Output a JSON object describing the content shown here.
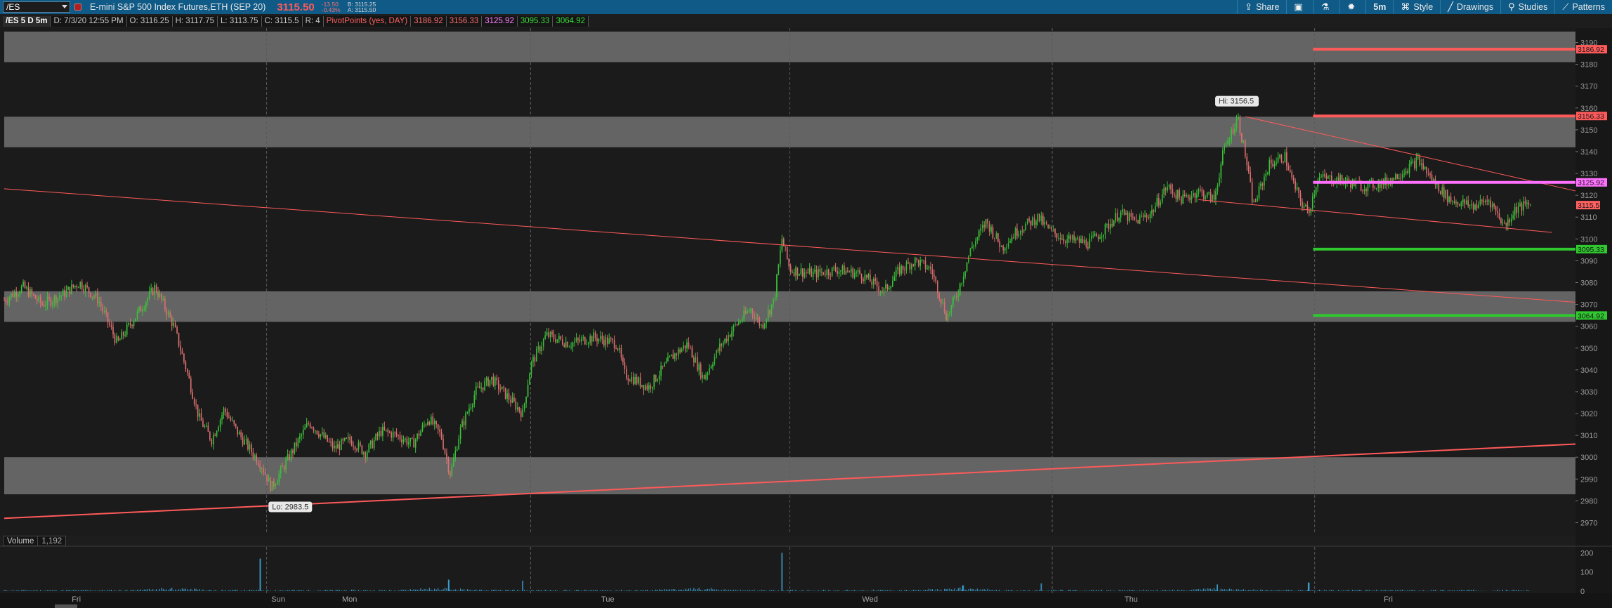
{
  "toolbar": {
    "symbol": "/ES",
    "instrument_title": "E-mini S&P 500 Index Futures,ETH (SEP 20)",
    "last_price": "3115.50",
    "change": "-13.50",
    "change_pct": "-0.43%",
    "bid": "B: 3115.25",
    "ask": "A: 3115.50",
    "buttons": [
      {
        "label": "Share",
        "icon": "share-icon"
      },
      {
        "label": "",
        "icon": "flag-icon"
      },
      {
        "label": "",
        "icon": "flask-icon"
      },
      {
        "label": "",
        "icon": "gear-icon"
      },
      {
        "label": "5m",
        "icon": ""
      },
      {
        "label": "Style",
        "icon": "style-icon"
      },
      {
        "label": "Drawings",
        "icon": "pencil-icon"
      },
      {
        "label": "Studies",
        "icon": "studies-icon"
      },
      {
        "label": "Patterns",
        "icon": "patterns-icon"
      }
    ],
    "share_label": "Share",
    "timeframe_label": "5m",
    "style_label": "Style",
    "drawings_label": "Drawings",
    "studies_label": "Studies",
    "patterns_label": "Patterns"
  },
  "info": {
    "symbol_period": "/ES 5 D 5m",
    "date_time": "D: 7/3/20 12:55 PM",
    "open": "O: 3116.25",
    "high": "H: 3117.75",
    "low": "L: 3113.75",
    "close": "C: 3115.5",
    "range": "R: 4",
    "pivot_label": "PivotPoints (yes, DAY)",
    "r2": "3186.92",
    "r1": "3156.33",
    "pivot": "3125.92",
    "s1": "3095.33",
    "s2": "3064.92"
  },
  "volume_panel": {
    "label": "Volume",
    "value": "1,192",
    "yaxis": [
      "200",
      "100",
      "0"
    ]
  },
  "colors": {
    "background": "#1d1d1d",
    "topbar": "#0f5a86",
    "up_candle": "#39c539",
    "down_candle": "#e07070",
    "resistance": "#ff5a5a",
    "pivot": "#ff70ff",
    "support": "#2fc92f",
    "zone": "#7d7d7d",
    "trendline": "#ff5a5a",
    "volume": "#3a9bc9"
  },
  "chart_data": {
    "type": "candlestick",
    "ylim": [
      2965,
      3195
    ],
    "yticks": [
      2970,
      2980,
      2990,
      3000,
      3010,
      3020,
      3030,
      3040,
      3050,
      3060,
      3070,
      3080,
      3090,
      3100,
      3110,
      3120,
      3130,
      3140,
      3150,
      3160,
      3170,
      3180,
      3190
    ],
    "day_labels": [
      "Fri",
      "Sun",
      "Mon",
      "Tue",
      "Wed",
      "Thu",
      "Fri"
    ],
    "session_breaks": [
      0.167,
      0.335,
      0.5,
      0.667,
      0.834
    ],
    "hi_label": "Hi: 3156.5",
    "lo_label": "Lo: 2983.5",
    "current_price_label": "3115.5",
    "zones": [
      {
        "from": 3181,
        "to": 3195
      },
      {
        "from": 3142,
        "to": 3156
      },
      {
        "from": 3062,
        "to": 3076
      },
      {
        "from": 2983,
        "to": 3000
      }
    ],
    "pivot_levels": [
      {
        "name": "R2",
        "value": 3186.92,
        "label": "3186.92",
        "color": "#ff5a5a"
      },
      {
        "name": "R1",
        "value": 3156.33,
        "label": "3156.33",
        "color": "#ff5a5a"
      },
      {
        "name": "PP",
        "value": 3125.92,
        "label": "3125.92",
        "color": "#ff70ff"
      },
      {
        "name": "S1",
        "value": 3095.33,
        "label": "3095.33",
        "color": "#2fc92f"
      },
      {
        "name": "S2",
        "value": 3064.92,
        "label": "3064.92",
        "color": "#2fc92f"
      }
    ],
    "pivot_start": 0.833,
    "path_points": [
      [
        0.0,
        3072
      ],
      [
        0.012,
        3078
      ],
      [
        0.024,
        3070
      ],
      [
        0.036,
        3074
      ],
      [
        0.048,
        3080
      ],
      [
        0.06,
        3072
      ],
      [
        0.072,
        3052
      ],
      [
        0.084,
        3065
      ],
      [
        0.096,
        3078
      ],
      [
        0.108,
        3060
      ],
      [
        0.116,
        3040
      ],
      [
        0.124,
        3018
      ],
      [
        0.132,
        3008
      ],
      [
        0.14,
        3022
      ],
      [
        0.148,
        3012
      ],
      [
        0.156,
        3004
      ],
      [
        0.164,
        2996
      ],
      [
        0.17,
        2986
      ],
      [
        0.178,
        2996
      ],
      [
        0.186,
        3006
      ],
      [
        0.194,
        3016
      ],
      [
        0.202,
        3010
      ],
      [
        0.21,
        3004
      ],
      [
        0.22,
        3008
      ],
      [
        0.23,
        3002
      ],
      [
        0.24,
        3012
      ],
      [
        0.25,
        3010
      ],
      [
        0.26,
        3006
      ],
      [
        0.27,
        3018
      ],
      [
        0.278,
        3010
      ],
      [
        0.284,
        2992
      ],
      [
        0.29,
        3012
      ],
      [
        0.3,
        3030
      ],
      [
        0.31,
        3036
      ],
      [
        0.32,
        3028
      ],
      [
        0.33,
        3020
      ],
      [
        0.335,
        3042
      ],
      [
        0.345,
        3056
      ],
      [
        0.36,
        3052
      ],
      [
        0.375,
        3055
      ],
      [
        0.39,
        3052
      ],
      [
        0.395,
        3038
      ],
      [
        0.41,
        3032
      ],
      [
        0.425,
        3046
      ],
      [
        0.435,
        3052
      ],
      [
        0.445,
        3036
      ],
      [
        0.455,
        3050
      ],
      [
        0.465,
        3060
      ],
      [
        0.475,
        3068
      ],
      [
        0.482,
        3060
      ],
      [
        0.49,
        3072
      ],
      [
        0.495,
        3100
      ],
      [
        0.5,
        3086
      ],
      [
        0.515,
        3084
      ],
      [
        0.53,
        3086
      ],
      [
        0.545,
        3084
      ],
      [
        0.56,
        3076
      ],
      [
        0.57,
        3086
      ],
      [
        0.58,
        3090
      ],
      [
        0.59,
        3086
      ],
      [
        0.6,
        3064
      ],
      [
        0.607,
        3076
      ],
      [
        0.615,
        3095
      ],
      [
        0.625,
        3108
      ],
      [
        0.635,
        3096
      ],
      [
        0.645,
        3104
      ],
      [
        0.658,
        3110
      ],
      [
        0.665,
        3104
      ],
      [
        0.675,
        3100
      ],
      [
        0.69,
        3098
      ],
      [
        0.7,
        3104
      ],
      [
        0.71,
        3112
      ],
      [
        0.72,
        3108
      ],
      [
        0.73,
        3112
      ],
      [
        0.74,
        3124
      ],
      [
        0.75,
        3118
      ],
      [
        0.76,
        3122
      ],
      [
        0.77,
        3118
      ],
      [
        0.776,
        3140
      ],
      [
        0.785,
        3156
      ],
      [
        0.79,
        3138
      ],
      [
        0.795,
        3115
      ],
      [
        0.805,
        3134
      ],
      [
        0.815,
        3138
      ],
      [
        0.82,
        3126
      ],
      [
        0.826,
        3116
      ],
      [
        0.83,
        3112
      ],
      [
        0.836,
        3128
      ],
      [
        0.85,
        3127
      ],
      [
        0.865,
        3124
      ],
      [
        0.88,
        3126
      ],
      [
        0.9,
        3136
      ],
      [
        0.91,
        3126
      ],
      [
        0.92,
        3118
      ],
      [
        0.935,
        3115
      ],
      [
        0.945,
        3118
      ],
      [
        0.955,
        3106
      ],
      [
        0.962,
        3114
      ],
      [
        0.972,
        3116
      ]
    ],
    "trendlines": [
      {
        "x1": 0.0,
        "y1": 3123,
        "x2": 1.0,
        "y2": 3071,
        "width": 1
      },
      {
        "x1": 0.0,
        "y1": 2972,
        "x2": 1.0,
        "y2": 3006,
        "width": 2
      },
      {
        "x1": 0.79,
        "y1": 3156,
        "x2": 1.0,
        "y2": 3122,
        "width": 1
      },
      {
        "x1": 0.76,
        "y1": 3118,
        "x2": 0.985,
        "y2": 3103,
        "width": 1
      }
    ],
    "volume_spikes": [
      {
        "x": 0.163,
        "v": 170
      },
      {
        "x": 0.495,
        "v": 200
      },
      {
        "x": 0.283,
        "v": 60
      },
      {
        "x": 0.33,
        "v": 55
      },
      {
        "x": 0.66,
        "v": 40
      },
      {
        "x": 0.83,
        "v": 45
      },
      {
        "x": 0.772,
        "v": 35
      },
      {
        "x": 0.61,
        "v": 30
      }
    ],
    "volume_ylim": [
      0,
      220
    ]
  }
}
